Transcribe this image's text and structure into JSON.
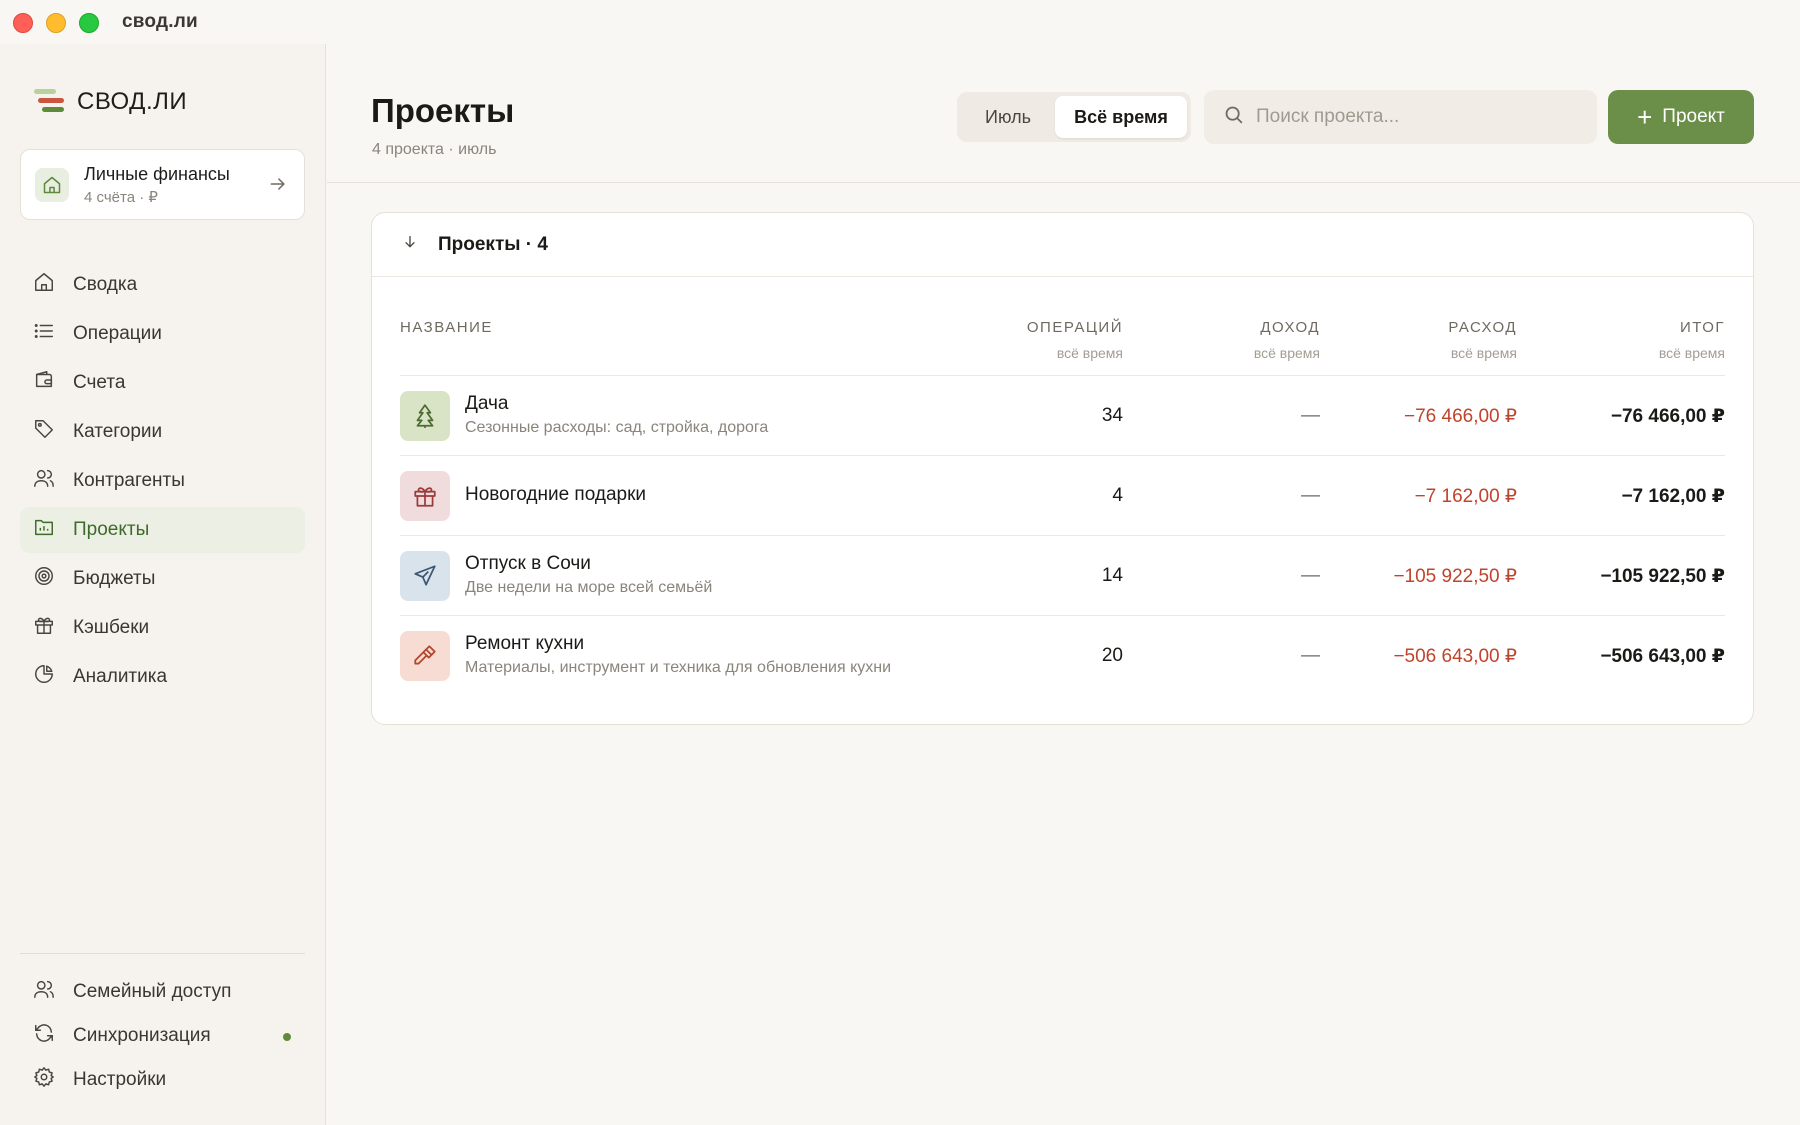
{
  "window": {
    "title": "свод.ли"
  },
  "brand": {
    "name": "СВОД.ЛИ"
  },
  "account": {
    "name": "Личные финансы",
    "sub": "4 счёта · ₽"
  },
  "nav": [
    {
      "label": "Сводка",
      "icon": "home-icon",
      "active": false
    },
    {
      "label": "Операции",
      "icon": "list-icon",
      "active": false
    },
    {
      "label": "Счета",
      "icon": "wallet-icon",
      "active": false
    },
    {
      "label": "Категории",
      "icon": "tag-icon",
      "active": false
    },
    {
      "label": "Контрагенты",
      "icon": "users-icon",
      "active": false
    },
    {
      "label": "Проекты",
      "icon": "projects-icon",
      "active": true
    },
    {
      "label": "Бюджеты",
      "icon": "target-icon",
      "active": false
    },
    {
      "label": "Кэшбеки",
      "icon": "gift-icon",
      "active": false
    },
    {
      "label": "Аналитика",
      "icon": "pie-chart-icon",
      "active": false
    }
  ],
  "footer_nav": [
    {
      "label": "Семейный доступ",
      "icon": "users-icon"
    },
    {
      "label": "Синхронизация",
      "icon": "sync-icon"
    },
    {
      "label": "Настройки",
      "icon": "gear-icon"
    }
  ],
  "header": {
    "title": "Проекты",
    "subtitle": "4 проекта · июль",
    "period_options": [
      "Июль",
      "Всё время"
    ],
    "period_selected": "Всё время",
    "search_placeholder": "Поиск проекта...",
    "add_label": "Проект"
  },
  "colors": {
    "accent": "#6b8f49",
    "expense": "#c0442b",
    "background": "#f9f7f3"
  },
  "table": {
    "group_title": "Проекты · 4",
    "columns": [
      {
        "label": "Название",
        "sub": ""
      },
      {
        "label": "Операций",
        "sub": "всё время"
      },
      {
        "label": "Доход",
        "sub": "всё время"
      },
      {
        "label": "Расход",
        "sub": "всё время"
      },
      {
        "label": "Итог",
        "sub": "всё время"
      }
    ],
    "rows": [
      {
        "name": "Дача",
        "desc": "Сезонные расходы: сад, стройка, дорога",
        "icon": "tree-icon",
        "icon_bg": "#d9e3c6",
        "icon_color": "#4d6b34",
        "ops": "34",
        "income": "—",
        "expense": "−76 466,00 ₽",
        "total": "−76 466,00 ₽"
      },
      {
        "name": "Новогодние подарки",
        "desc": "",
        "icon": "gift-icon",
        "icon_bg": "#f0dcdc",
        "icon_color": "#9b3b3b",
        "ops": "4",
        "income": "—",
        "expense": "−7 162,00 ₽",
        "total": "−7 162,00 ₽"
      },
      {
        "name": "Отпуск в Сочи",
        "desc": "Две недели на море всей семьёй",
        "icon": "plane-icon",
        "icon_bg": "#d8e3ec",
        "icon_color": "#3d5670",
        "ops": "14",
        "income": "—",
        "expense": "−105 922,50 ₽",
        "total": "−105 922,50 ₽"
      },
      {
        "name": "Ремонт кухни",
        "desc": "Материалы, инструмент и техника для обновления кухни",
        "icon": "hammer-icon",
        "icon_bg": "#f6dcd2",
        "icon_color": "#b3452d",
        "ops": "20",
        "income": "—",
        "expense": "−506 643,00 ₽",
        "total": "−506 643,00 ₽"
      }
    ]
  }
}
